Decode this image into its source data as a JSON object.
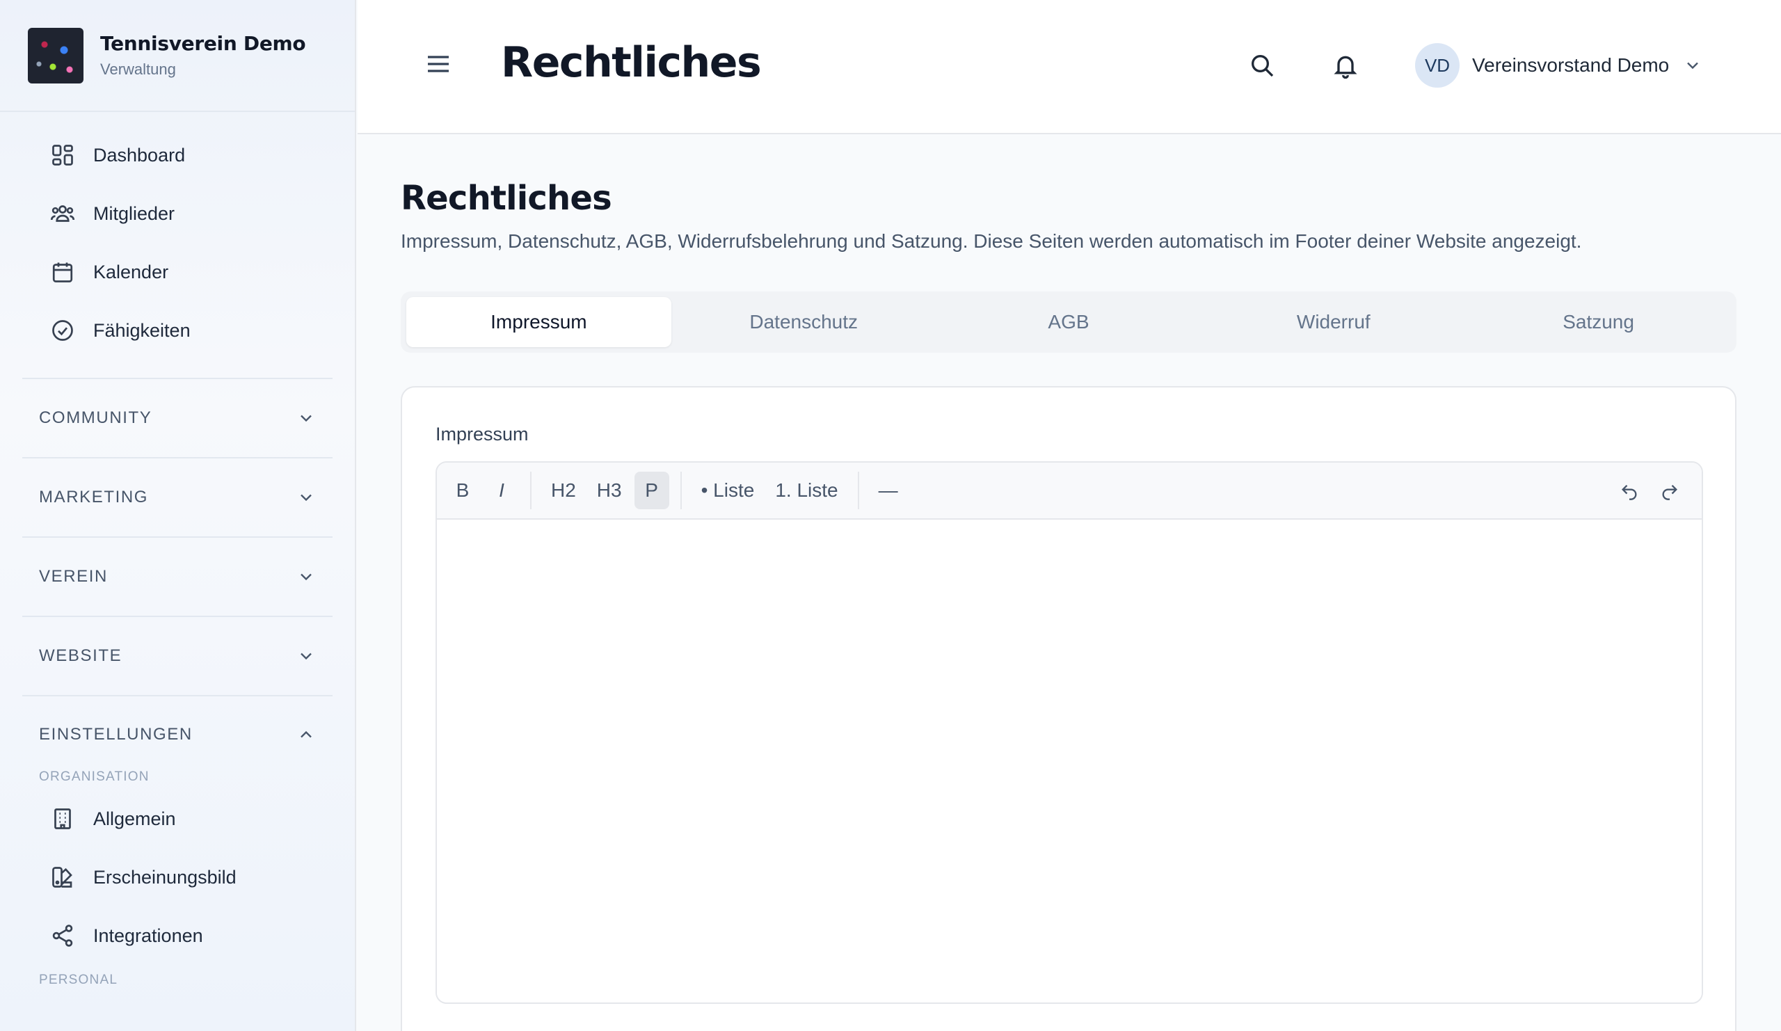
{
  "brand": {
    "name": "Tennisverein Demo",
    "subtitle": "Verwaltung"
  },
  "sidebar": {
    "main_items": [
      {
        "label": "Dashboard",
        "icon": "dashboard-icon"
      },
      {
        "label": "Mitglieder",
        "icon": "members-icon"
      },
      {
        "label": "Kalender",
        "icon": "calendar-icon"
      },
      {
        "label": "Fähigkeiten",
        "icon": "check-circle-icon"
      }
    ],
    "sections": [
      {
        "label": "COMMUNITY",
        "expanded": false
      },
      {
        "label": "MARKETING",
        "expanded": false
      },
      {
        "label": "VEREIN",
        "expanded": false
      },
      {
        "label": "WEBSITE",
        "expanded": false
      },
      {
        "label": "EINSTELLUNGEN",
        "expanded": true
      }
    ],
    "settings": {
      "group1_label": "ORGANISATION",
      "items": [
        {
          "label": "Allgemein",
          "icon": "building-icon"
        },
        {
          "label": "Erscheinungsbild",
          "icon": "palette-icon"
        },
        {
          "label": "Integrationen",
          "icon": "share-icon"
        }
      ],
      "group2_label": "PERSONAL"
    }
  },
  "topbar": {
    "title": "Rechtliches",
    "user": {
      "initials": "VD",
      "name": "Vereinsvorstand Demo"
    }
  },
  "page": {
    "title": "Rechtliches",
    "description": "Impressum, Datenschutz, AGB, Widerrufsbelehrung und Satzung. Diese Seiten werden automatisch im Footer deiner Website angezeigt.",
    "tabs": [
      {
        "label": "Impressum",
        "active": true
      },
      {
        "label": "Datenschutz",
        "active": false
      },
      {
        "label": "AGB",
        "active": false
      },
      {
        "label": "Widerruf",
        "active": false
      },
      {
        "label": "Satzung",
        "active": false
      }
    ]
  },
  "editor": {
    "field_label": "Impressum",
    "toolbar": {
      "bold": "B",
      "italic": "I",
      "h2": "H2",
      "h3": "H3",
      "paragraph": "P",
      "bullet_list": "• Liste",
      "ordered_list": "1. Liste",
      "horizontal_rule": "—"
    },
    "content": ""
  }
}
